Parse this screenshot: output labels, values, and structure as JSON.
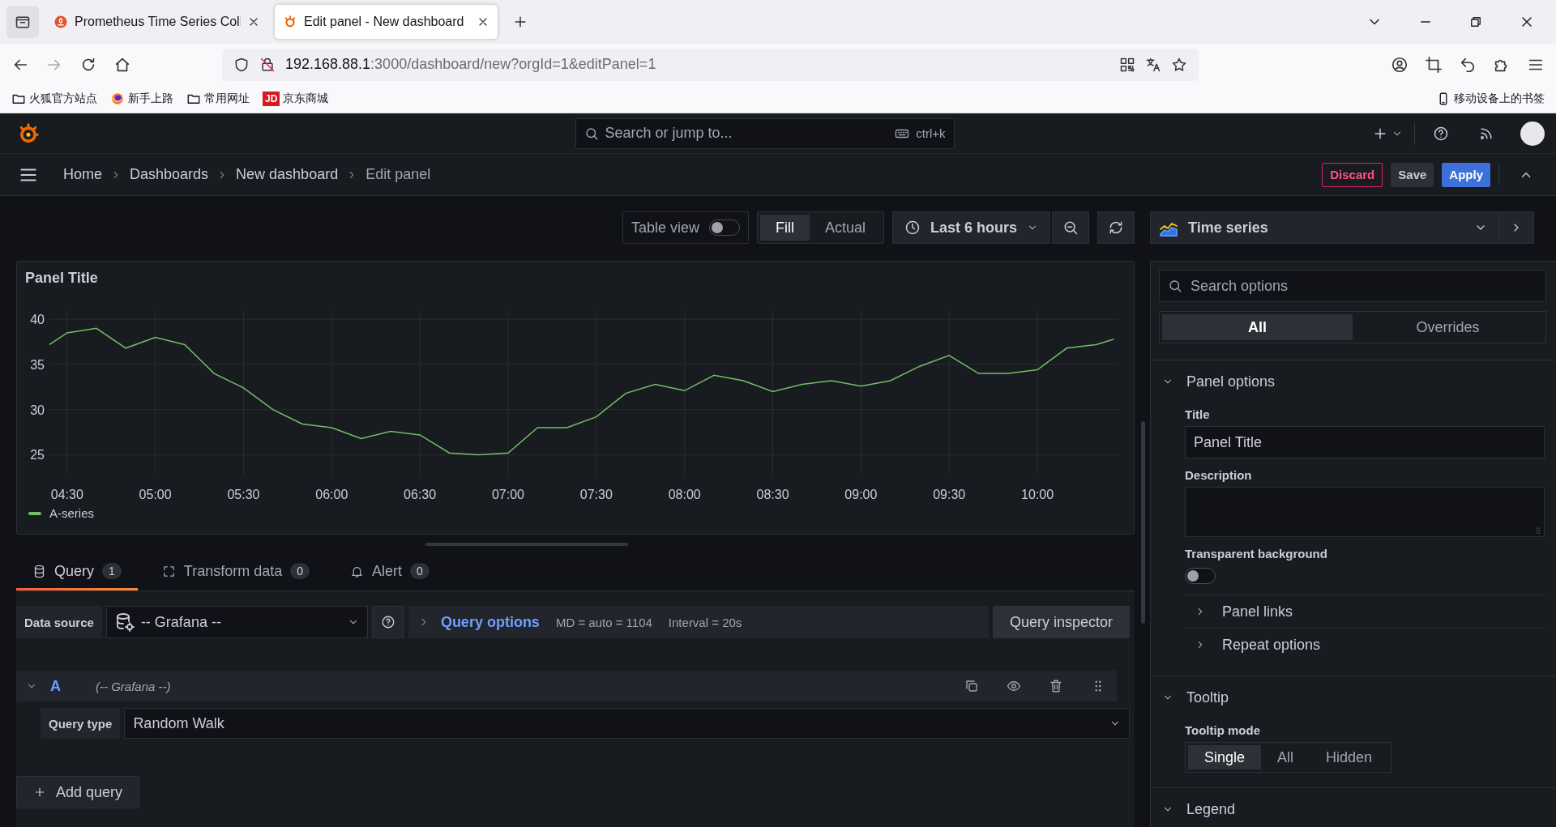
{
  "browser": {
    "tabs": [
      {
        "title": "Prometheus Time Series Coll",
        "kind": "prometheus",
        "selected": false
      },
      {
        "title": "Edit panel - New dashboard",
        "kind": "grafana",
        "selected": true
      }
    ],
    "url_host": "192.168.88.1",
    "url_path": ":3000/dashboard/new?orgId=1&editPanel=1",
    "bookmarks": [
      {
        "label": "火狐官方站点",
        "kind": "folder"
      },
      {
        "label": "新手上路",
        "kind": "firefox"
      },
      {
        "label": "常用网址",
        "kind": "folder"
      },
      {
        "label": "京东商城",
        "kind": "jd",
        "icon_text": "JD"
      }
    ],
    "mobile_bookmarks": "移动设备上的书签"
  },
  "search": {
    "placeholder": "Search or jump to...",
    "shortcut": "ctrl+k"
  },
  "breadcrumbs": [
    {
      "label": "Home",
      "current": false
    },
    {
      "label": "Dashboards",
      "current": false
    },
    {
      "label": "New dashboard",
      "current": false
    },
    {
      "label": "Edit panel",
      "current": true
    }
  ],
  "actions": [
    {
      "label": "Discard",
      "kind": "danger"
    },
    {
      "label": "Save",
      "kind": "secondary"
    },
    {
      "label": "Apply",
      "kind": "primary"
    }
  ],
  "toolbar": {
    "table_view": {
      "label": "Table view",
      "on": false
    },
    "fill_modes": [
      {
        "label": "Fill",
        "selected": true
      },
      {
        "label": "Actual",
        "selected": false
      }
    ],
    "time_range": "Last 6 hours"
  },
  "panel": {
    "title": "Panel Title",
    "chart_data": {
      "type": "line",
      "x": [
        264,
        270,
        280,
        290,
        300,
        310,
        320,
        330,
        340,
        350,
        360,
        370,
        380,
        390,
        400,
        410,
        420,
        430,
        440,
        450,
        460,
        470,
        480,
        490,
        500,
        510,
        520,
        530,
        540,
        550,
        560,
        570,
        580,
        590,
        600,
        610,
        620,
        626
      ],
      "series": [
        {
          "name": "A-series",
          "color": "#73bf69",
          "values": [
            37.2,
            38.5,
            39.0,
            36.8,
            38.0,
            37.2,
            34.0,
            32.4,
            30.0,
            28.4,
            28.0,
            26.8,
            27.6,
            27.2,
            25.2,
            25.0,
            25.2,
            28.0,
            28.0,
            29.2,
            31.8,
            32.8,
            32.1,
            33.8,
            33.2,
            32.0,
            32.8,
            33.2,
            32.6,
            33.2,
            34.8,
            36.0,
            34.0,
            34.0,
            34.4,
            36.8,
            37.2,
            37.8
          ]
        }
      ],
      "xlim": [
        264,
        627
      ],
      "ylim": [
        22.8,
        41
      ],
      "grid": true,
      "xticks": [
        {
          "value": 270,
          "label": "04:30"
        },
        {
          "value": 300,
          "label": "05:00"
        },
        {
          "value": 330,
          "label": "05:30"
        },
        {
          "value": 360,
          "label": "06:00"
        },
        {
          "value": 390,
          "label": "06:30"
        },
        {
          "value": 420,
          "label": "07:00"
        },
        {
          "value": 450,
          "label": "07:30"
        },
        {
          "value": 480,
          "label": "08:00"
        },
        {
          "value": 510,
          "label": "08:30"
        },
        {
          "value": 540,
          "label": "09:00"
        },
        {
          "value": 570,
          "label": "09:30"
        },
        {
          "value": 600,
          "label": "10:00"
        }
      ],
      "yticks": [
        25,
        30,
        35,
        40
      ]
    }
  },
  "query_tabs": [
    {
      "label": "Query",
      "count": "1",
      "kind": "query",
      "selected": true
    },
    {
      "label": "Transform data",
      "count": "0",
      "kind": "transform",
      "selected": false
    },
    {
      "label": "Alert",
      "count": "0",
      "kind": "alert",
      "selected": false
    }
  ],
  "datasource": {
    "label": "Data source",
    "value": "-- Grafana --"
  },
  "query_options": {
    "label": "Query options",
    "md": "MD = auto = 1104",
    "interval": "Interval = 20s"
  },
  "query_inspector": "Query inspector",
  "queries": [
    {
      "ref": "A",
      "source": "(-- Grafana --)",
      "expanded": true,
      "query_type_label": "Query type",
      "query_type": "Random Walk"
    }
  ],
  "add_query": "Add query",
  "visualization": "Time series",
  "options": {
    "search_placeholder": "Search options",
    "tabs": [
      {
        "label": "All",
        "selected": true
      },
      {
        "label": "Overrides",
        "selected": false
      }
    ],
    "sections": [
      {
        "title": "Panel options",
        "expanded": true,
        "items": [
          {
            "kind": "text",
            "label": "Title",
            "value": "Panel Title"
          },
          {
            "kind": "textarea",
            "label": "Description"
          },
          {
            "kind": "switch",
            "label": "Transparent background",
            "on": false
          },
          {
            "kind": "group",
            "title": "Panel links",
            "expanded": false
          },
          {
            "kind": "group",
            "title": "Repeat options",
            "expanded": false
          }
        ]
      },
      {
        "title": "Tooltip",
        "expanded": true,
        "items": [
          {
            "kind": "radio",
            "label": "Tooltip mode",
            "options": [
              {
                "label": "Single",
                "selected": true
              },
              {
                "label": "All",
                "selected": false
              },
              {
                "label": "Hidden",
                "selected": false
              }
            ]
          }
        ]
      },
      {
        "title": "Legend",
        "expanded": true
      }
    ]
  }
}
